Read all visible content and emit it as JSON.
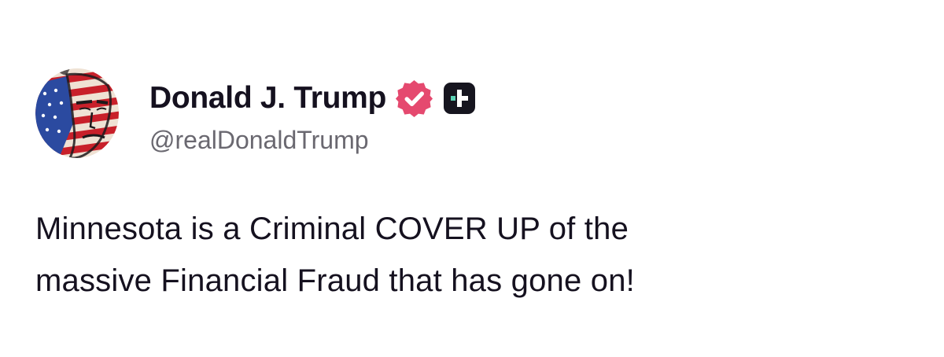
{
  "author": {
    "display_name": "Donald J. Trump",
    "handle": "@realDonaldTrump",
    "avatar_icon": "avatar-flag-portrait",
    "verified_icon": "verified-check-icon",
    "verified_color": "#e5496f",
    "plus_icon": "plus-badge-icon",
    "plus_badge_color": "#16151f",
    "plus_accent_color": "#5ad2b4"
  },
  "post": {
    "lines": [
      "Minnesota is a Criminal COVER UP of the",
      "massive Financial Fraud that has gone on!"
    ]
  }
}
